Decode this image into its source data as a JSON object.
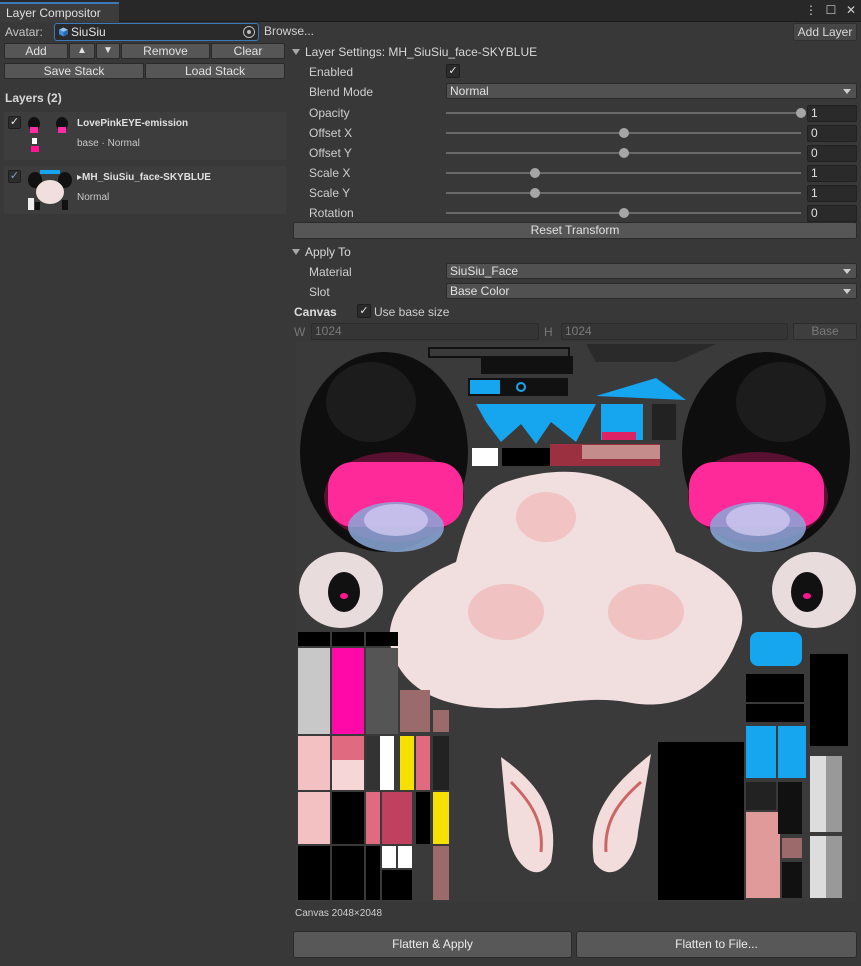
{
  "window": {
    "tab_title": "Layer Compositor",
    "icons": [
      "more-vert-icon",
      "maximize-icon",
      "close-icon"
    ]
  },
  "avatar": {
    "label": "Avatar:",
    "value": "SiuSiu",
    "browse_label": "Browse...",
    "add_layer_label": "Add Layer"
  },
  "toolbar": {
    "add_label": "Add",
    "up_label": "▲",
    "down_label": "▼",
    "remove_label": "Remove",
    "clear_label": "Clear",
    "save_stack_label": "Save Stack",
    "load_stack_label": "Load Stack"
  },
  "layers": {
    "title": "Layers (2)",
    "items": [
      {
        "name": "LovePinkEYE-emission",
        "sub": "base · Normal",
        "checked": true
      },
      {
        "name": "▸MH_SiuSiu_face-SKYBLUE",
        "sub": "Normal",
        "checked": true
      }
    ]
  },
  "settings": {
    "header": "Layer Settings: MH_SiuSiu_face-SKYBLUE",
    "enabled_label": "Enabled",
    "enabled": "✓",
    "blend_label": "Blend Mode",
    "blend_value": "Normal",
    "sliders": [
      {
        "label": "Opacity",
        "value": "1",
        "fraction": 1.0
      },
      {
        "label": "Offset X",
        "value": "0",
        "fraction": 0.5
      },
      {
        "label": "Offset Y",
        "value": "0",
        "fraction": 0.5
      },
      {
        "label": "Scale X",
        "value": "1",
        "fraction": 0.25
      },
      {
        "label": "Scale Y",
        "value": "1",
        "fraction": 0.25
      },
      {
        "label": "Rotation",
        "value": "0",
        "fraction": 0.5
      }
    ],
    "reset_label": "Reset Transform"
  },
  "apply_to": {
    "header": "Apply To",
    "material_label": "Material",
    "material_value": "SiuSiu_Face",
    "slot_label": "Slot",
    "slot_value": "Base Color"
  },
  "canvas": {
    "title": "Canvas",
    "use_base_label": "Use base size",
    "use_base_checked": "✓",
    "w_label": "W",
    "w_value": "1024",
    "h_label": "H",
    "h_value": "1024",
    "base_label": "Base",
    "caption": "Canvas 2048×2048"
  },
  "actions": {
    "flatten_apply_label": "Flatten & Apply",
    "flatten_file_label": "Flatten to File..."
  },
  "colors": {
    "accent": "#3a79bb",
    "cyan": "#16a6f0",
    "pink": "#ff1493",
    "skin": "#f1dede"
  }
}
